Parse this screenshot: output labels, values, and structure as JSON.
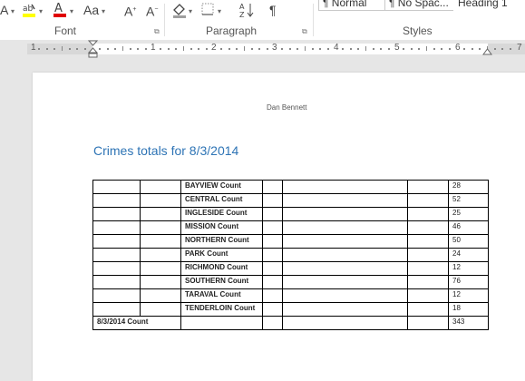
{
  "ribbon": {
    "groups": {
      "font": "Font",
      "paragraph": "Paragraph",
      "styles": "Styles"
    },
    "font_case_label": "Aa",
    "styles": [
      "¶ Normal",
      "¶ No Spac...",
      "Heading 1"
    ]
  },
  "ruler": {
    "numbers": [
      "1",
      "1",
      "2",
      "3",
      "4",
      "5",
      "6",
      "7"
    ]
  },
  "document": {
    "header": "Dan Bennett",
    "title": "Crimes totals for 8/3/2014",
    "rows": [
      {
        "label": "BAYVIEW Count",
        "value": "28"
      },
      {
        "label": "CENTRAL Count",
        "value": "52"
      },
      {
        "label": "INGLESIDE Count",
        "value": "25"
      },
      {
        "label": "MISSION Count",
        "value": "46"
      },
      {
        "label": "NORTHERN Count",
        "value": "50"
      },
      {
        "label": "PARK Count",
        "value": "24"
      },
      {
        "label": "RICHMOND Count",
        "value": "12"
      },
      {
        "label": "SOUTHERN Count",
        "value": "76"
      },
      {
        "label": "TARAVAL Count",
        "value": "12"
      },
      {
        "label": "TENDERLOIN Count",
        "value": "18"
      }
    ],
    "total": {
      "label": "8/3/2014 Count",
      "value": "343"
    }
  }
}
